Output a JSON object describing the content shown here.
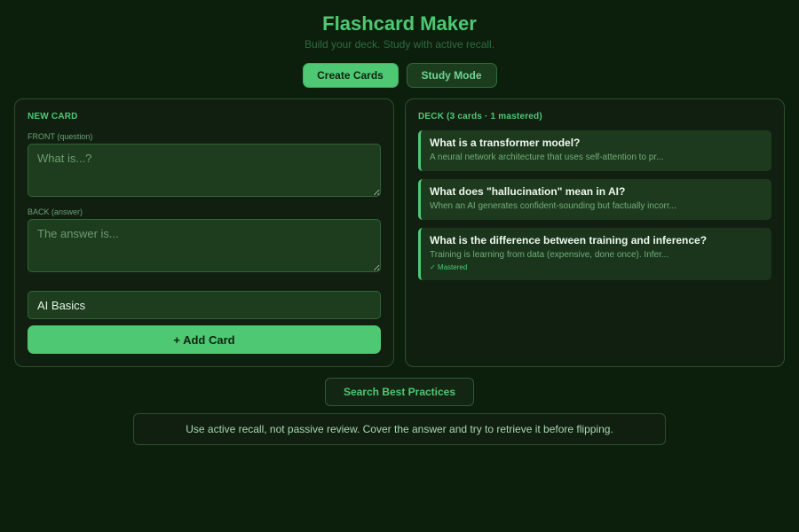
{
  "header": {
    "title": "Flashcard Maker",
    "subtitle": "Build your deck. Study with active recall."
  },
  "tabs": [
    {
      "label": "Create Cards",
      "active": true
    },
    {
      "label": "Study Mode",
      "active": false
    }
  ],
  "new_card": {
    "section_title": "NEW CARD",
    "front_label": "FRONT (question)",
    "front_placeholder": "What is...?",
    "back_label": "BACK (answer)",
    "back_placeholder": "The answer is...",
    "category_value": "AI Basics",
    "add_button_label": "+ Add Card"
  },
  "deck": {
    "section_title": "DECK (3 cards · 1 mastered)",
    "cards": [
      {
        "question": "What is a transformer model?",
        "answer": "A neural network architecture that uses self-attention to pr...",
        "mastered_label": ""
      },
      {
        "question": "What does \"hallucination\" mean in AI?",
        "answer": "When an AI generates confident-sounding but factually incorr...",
        "mastered_label": ""
      },
      {
        "question": "What is the difference between training and inference?",
        "answer": "Training is learning from data (expensive, done once). Infer...",
        "mastered_label": "✓ Mastered"
      }
    ]
  },
  "search_button_label": "Search Best Practices",
  "tip_text": "Use active recall, not passive review. Cover the answer and try to retrieve it before flipping.",
  "colors": {
    "background": "#0c1f0c",
    "accent": "#4fc873",
    "panel": "#111f11",
    "card": "#1e3a1e"
  }
}
